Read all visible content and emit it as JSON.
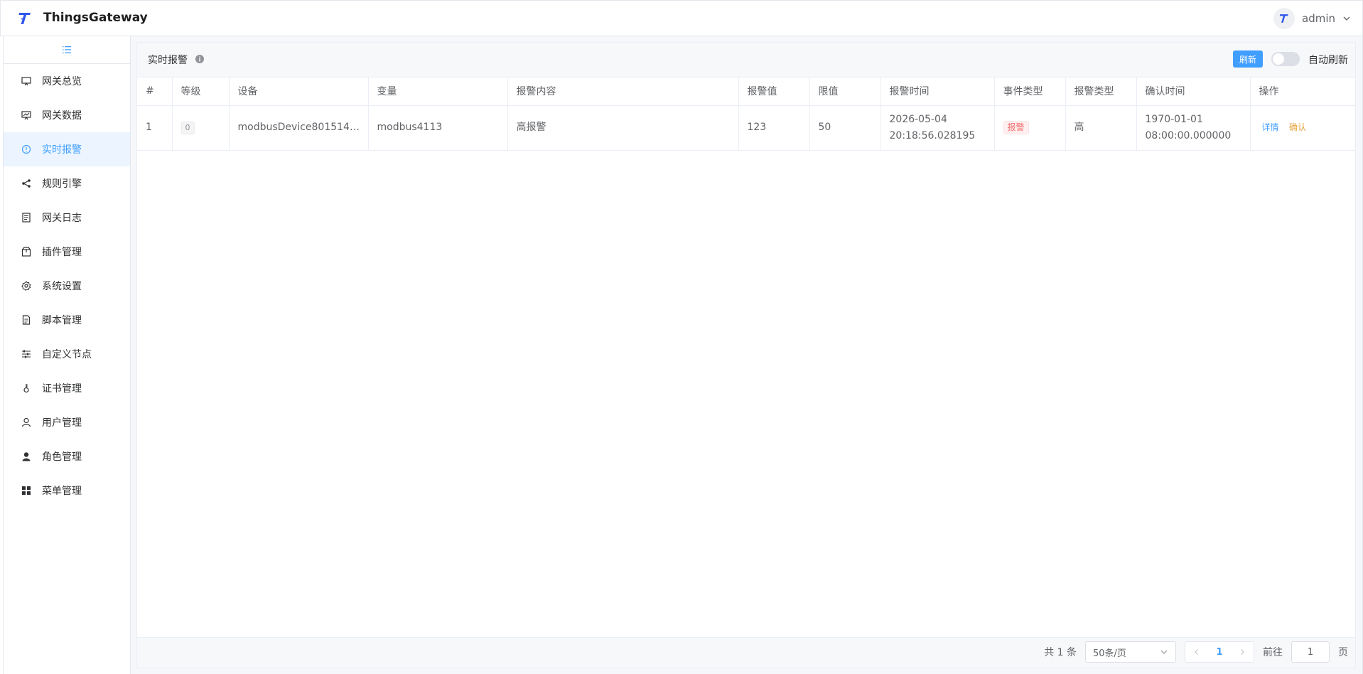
{
  "app": {
    "title": "ThingsGateway",
    "user": "admin",
    "accent": "#409eff"
  },
  "sidebar": {
    "items": [
      {
        "label": "网关总览",
        "icon": "monitor-icon",
        "active": false
      },
      {
        "label": "网关数据",
        "icon": "chart-board-icon",
        "active": false
      },
      {
        "label": "实时报警",
        "icon": "alert-circle-icon",
        "active": true
      },
      {
        "label": "规则引擎",
        "icon": "share-icon",
        "active": false
      },
      {
        "label": "网关日志",
        "icon": "document-icon",
        "active": false
      },
      {
        "label": "插件管理",
        "icon": "box-icon",
        "active": false
      },
      {
        "label": "系统设置",
        "icon": "gear-icon",
        "active": false
      },
      {
        "label": "脚本管理",
        "icon": "file-icon",
        "active": false
      },
      {
        "label": "自定义节点",
        "icon": "sliders-icon",
        "active": false
      },
      {
        "label": "证书管理",
        "icon": "key-icon",
        "active": false
      },
      {
        "label": "用户管理",
        "icon": "user-icon",
        "active": false
      },
      {
        "label": "角色管理",
        "icon": "user-filled-icon",
        "active": false
      },
      {
        "label": "菜单管理",
        "icon": "grid-icon",
        "active": false
      }
    ]
  },
  "panel": {
    "title": "实时报警",
    "refresh_label": "刷新",
    "auto_refresh_label": "自动刷新",
    "auto_refresh_on": false
  },
  "table": {
    "columns": [
      "#",
      "等级",
      "设备",
      "变量",
      "报警内容",
      "报警值",
      "限值",
      "报警时间",
      "事件类型",
      "报警类型",
      "确认时间",
      "操作"
    ],
    "rows": [
      {
        "index": "1",
        "level": "0",
        "device": "modbusDevice8015147…",
        "variable": "modbus4113",
        "content": "高报警",
        "value": "123",
        "limit": "50",
        "alarm_date": "2026-05-04",
        "alarm_time": "20:18:56.028195",
        "event_type": "报警",
        "alarm_type": "高",
        "confirm_date": "1970-01-01",
        "confirm_time": "08:00:00.000000",
        "action_detail": "详情",
        "action_confirm": "确认"
      }
    ]
  },
  "pagination": {
    "total": "共 1 条",
    "page_size": "50条/页",
    "current_page": "1",
    "goto_label": "前往",
    "goto_value": "1",
    "page_unit": "页"
  }
}
